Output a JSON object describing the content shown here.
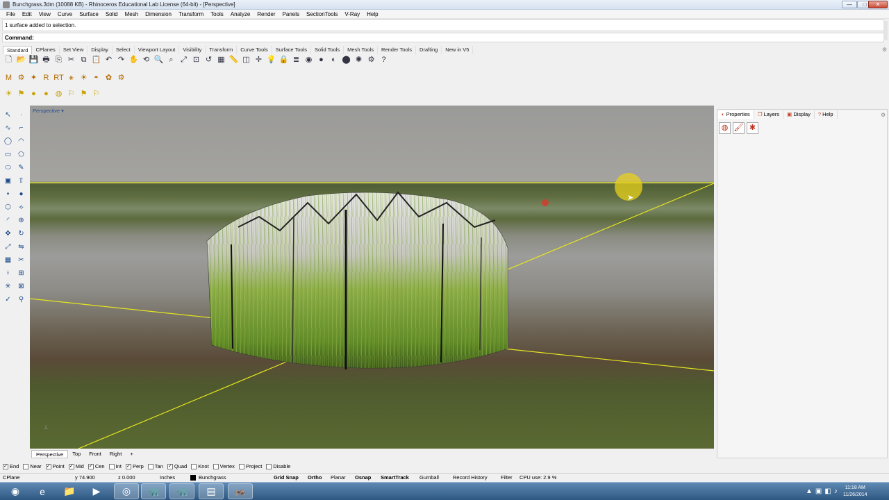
{
  "window": {
    "title": "Bunchgrass.3dm (10088 KB) - Rhinoceros Educational Lab License (64-bit) - [Perspective]",
    "minimize": "—",
    "maximize": "□",
    "close": "✕"
  },
  "menu": [
    "File",
    "Edit",
    "View",
    "Curve",
    "Surface",
    "Solid",
    "Mesh",
    "Dimension",
    "Transform",
    "Tools",
    "Analyze",
    "Render",
    "Panels",
    "SectionTools",
    "V-Ray",
    "Help"
  ],
  "command": {
    "history": "1 surface added to selection.",
    "prompt_label": "Command:",
    "value": ""
  },
  "toolbar_tabs": [
    "Standard",
    "CPlanes",
    "Set View",
    "Display",
    "Select",
    "Viewport Layout",
    "Visibility",
    "Transform",
    "Curve Tools",
    "Surface Tools",
    "Solid Tools",
    "Mesh Tools",
    "Render Tools",
    "Drafting",
    "New in V5"
  ],
  "toolbar_tabs_active": 0,
  "toolbar_row1": [
    "new-icon",
    "open-icon",
    "save-icon",
    "print-icon",
    "import-icon",
    "cut-icon",
    "copy-icon",
    "paste-icon",
    "undo-icon",
    "redo-icon",
    "pan-icon",
    "rotate-view-icon",
    "zoom-icon",
    "zoom-window-icon",
    "zoom-extents-icon",
    "zoom-selected-icon",
    "undo-view-icon",
    "four-viewports-icon",
    "ruler-icon",
    "cplane-icon",
    "osnap-icon",
    "light-icon",
    "lock-icon",
    "layer-icon",
    "color-icon",
    "shaded-icon",
    "rendered-icon",
    "render-icon",
    "sun-icon",
    "settings-icon",
    "help-icon"
  ],
  "toolbar_row1_glyphs": [
    "🗋",
    "📂",
    "💾",
    "🖶",
    "⎘",
    "✂",
    "⧉",
    "📋",
    "↶",
    "↷",
    "✋",
    "⟲",
    "🔍",
    "⌕",
    "⤢",
    "⊡",
    "↺",
    "▦",
    "📏",
    "◫",
    "✛",
    "💡",
    "🔒",
    "≣",
    "◉",
    "●",
    "◐",
    "⬤",
    "✺",
    "⚙",
    "?"
  ],
  "toolbar_row2": [
    "vray-material-icon",
    "vray-options-icon",
    "vray-light-icon",
    "vray-render-icon",
    "vray-rt-icon",
    "vray-fur-icon",
    "vray-sun-icon",
    "vray-dome-icon",
    "vray-proxy-icon",
    "vray-help-icon"
  ],
  "toolbar_row2_glyphs": [
    "M",
    "⚙",
    "✦",
    "R",
    "RT",
    "⚹",
    "☀",
    "◓",
    "✿",
    "⚙"
  ],
  "toolbar_row3": [
    "sun-light-icon",
    "spot-light-icon",
    "omni-light-icon",
    "sphere-light-icon",
    "ies-light-icon",
    "rect-light-icon",
    "flag-light-icon",
    "mesh-light-icon"
  ],
  "toolbar_row3_glyphs": [
    "☀",
    "⚑",
    "●",
    "●",
    "◍",
    "⚐",
    "⚑",
    "⚐"
  ],
  "left_tools": [
    "select-icon",
    "point-icon",
    "curve-icon",
    "polyline-icon",
    "circle-icon",
    "arc-icon",
    "rectangle-icon",
    "polygon-icon",
    "ellipse-icon",
    "freeform-icon",
    "surface-icon",
    "extrude-icon",
    "solid-box-icon",
    "sphere-icon",
    "mesh-icon",
    "loft-icon",
    "fillet-icon",
    "boolean-icon",
    "move-icon",
    "rotate-icon",
    "scale-icon",
    "mirror-icon",
    "array-icon",
    "trim-icon",
    "split-icon",
    "join-icon",
    "explode-icon",
    "group-icon",
    "check-icon",
    "analyze-icon"
  ],
  "left_glyphs": [
    "↖",
    "·",
    "∿",
    "⌐",
    "◯",
    "◠",
    "▭",
    "⬠",
    "⬭",
    "✎",
    "▣",
    "⇧",
    "▪",
    "●",
    "⬡",
    "⟡",
    "◜",
    "⊕",
    "✥",
    "↻",
    "⤢",
    "⇋",
    "▦",
    "✂",
    "⟊",
    "⊞",
    "✳",
    "⊠",
    "✓",
    "⚲"
  ],
  "viewport": {
    "label": "Perspective",
    "tabs": [
      "Perspective",
      "Top",
      "Front",
      "Right",
      "+"
    ],
    "active": 0
  },
  "panel": {
    "tabs": [
      "Properties",
      "Layers",
      "Display",
      "Help"
    ],
    "active": 0,
    "icons": [
      "object-properties-icon",
      "material-icon",
      "render-properties-icon"
    ]
  },
  "osnaps": [
    {
      "label": "End",
      "checked": true
    },
    {
      "label": "Near",
      "checked": false
    },
    {
      "label": "Point",
      "checked": true
    },
    {
      "label": "Mid",
      "checked": true
    },
    {
      "label": "Cen",
      "checked": true
    },
    {
      "label": "Int",
      "checked": false
    },
    {
      "label": "Perp",
      "checked": true
    },
    {
      "label": "Tan",
      "checked": false
    },
    {
      "label": "Quad",
      "checked": true
    },
    {
      "label": "Knot",
      "checked": false
    },
    {
      "label": "Vertex",
      "checked": false
    },
    {
      "label": "Project",
      "checked": false
    },
    {
      "label": "Disable",
      "checked": false
    }
  ],
  "status": {
    "cplane": "CPlane",
    "y": "y 74.900",
    "z": "z 0.000",
    "units": "Inches",
    "layer": "Bunchgrass",
    "grid_snap": "Grid Snap",
    "ortho": "Ortho",
    "planar": "Planar",
    "osnap": "Osnap",
    "smarttrack": "SmartTrack",
    "gumball": "Gumball",
    "record_history": "Record History",
    "filter": "Filter",
    "cpu": "CPU use: 2.9 %"
  },
  "taskbar": {
    "apps": [
      "start-orb-icon",
      "ie-icon",
      "explorer-icon",
      "media-player-icon",
      "chrome-icon",
      "rhino-icon",
      "rhino-app-icon",
      "notepad-icon",
      "grasshopper-icon"
    ],
    "glyphs": [
      "◉",
      "e",
      "📁",
      "▶",
      "◎",
      "🦏",
      "🦏",
      "▤",
      "🦗"
    ],
    "time": "11:18 AM",
    "date": "11/26/2014"
  }
}
